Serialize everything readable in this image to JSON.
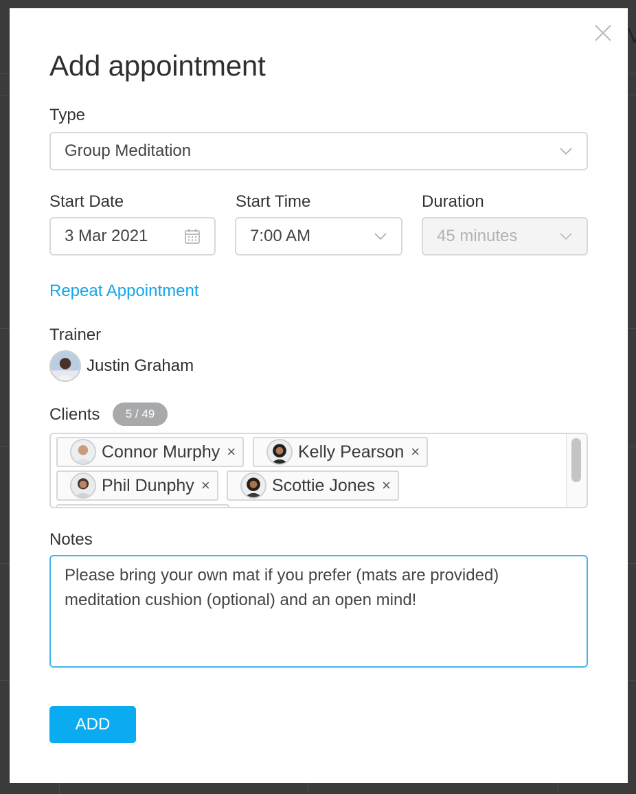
{
  "modal": {
    "title": "Add appointment",
    "close_icon": "close-icon"
  },
  "type": {
    "label": "Type",
    "value": "Group Meditation",
    "icon": "chevron-down-icon"
  },
  "start_date": {
    "label": "Start Date",
    "value": "3 Mar 2021",
    "icon": "calendar-icon"
  },
  "start_time": {
    "label": "Start Time",
    "value": "7:00 AM",
    "icon": "chevron-down-icon"
  },
  "duration": {
    "label": "Duration",
    "value": "45 minutes",
    "disabled": true,
    "icon": "chevron-down-icon"
  },
  "repeat_link": "Repeat Appointment",
  "trainer": {
    "label": "Trainer",
    "name": "Justin Graham"
  },
  "clients": {
    "label": "Clients",
    "count": "5 / 49",
    "items": [
      {
        "name": "Connor Murphy",
        "remove": "×"
      },
      {
        "name": "Kelly Pearson",
        "remove": "×"
      },
      {
        "name": "Phil Dunphy",
        "remove": "×"
      },
      {
        "name": "Scottie Jones",
        "remove": "×"
      }
    ]
  },
  "notes": {
    "label": "Notes",
    "value": "Please bring your own mat if you prefer (mats are provided) meditation cushion (optional) and an open mind!"
  },
  "add_button": "ADD",
  "colors": {
    "accent": "#0aabf0",
    "link": "#12a6e8",
    "focus_border": "#3fb6ea",
    "badge": "#a7a9ab"
  }
}
